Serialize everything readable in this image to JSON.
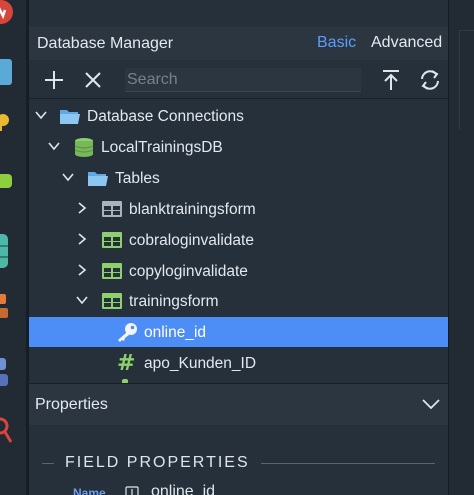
{
  "header": {
    "title": "Database Manager",
    "mode_basic": "Basic",
    "mode_advanced": "Advanced"
  },
  "toolbar": {
    "search_placeholder": "Search"
  },
  "tree": [
    {
      "label": "Database Connections",
      "icon": "folder-open-icon",
      "expanded": true
    },
    {
      "label": "LocalTrainingsDB",
      "icon": "database-icon",
      "expanded": true
    },
    {
      "label": "Tables",
      "icon": "folder-open-icon",
      "expanded": true
    },
    {
      "label": "blanktrainingsform",
      "icon": "table-gray-icon",
      "expanded": false
    },
    {
      "label": "cobraloginvalidate",
      "icon": "table-green-icon",
      "expanded": false
    },
    {
      "label": "copyloginvalidate",
      "icon": "table-green-icon",
      "expanded": false
    },
    {
      "label": "trainingsform",
      "icon": "table-green-icon",
      "expanded": true
    },
    {
      "label": "online_id",
      "icon": "key-icon",
      "selected": true
    },
    {
      "label": "apo_Kunden_ID",
      "icon": "hash-icon",
      "glyph": "#"
    }
  ],
  "properties": {
    "title": "Properties",
    "section_title": "FIELD PROPERTIES",
    "field_label": "Name",
    "field_value": "online_id"
  },
  "colors": {
    "accent": "#5b9dff",
    "selection": "#4d8df6",
    "table_green": "#8dd06c",
    "panel_bg": "#26303b"
  }
}
